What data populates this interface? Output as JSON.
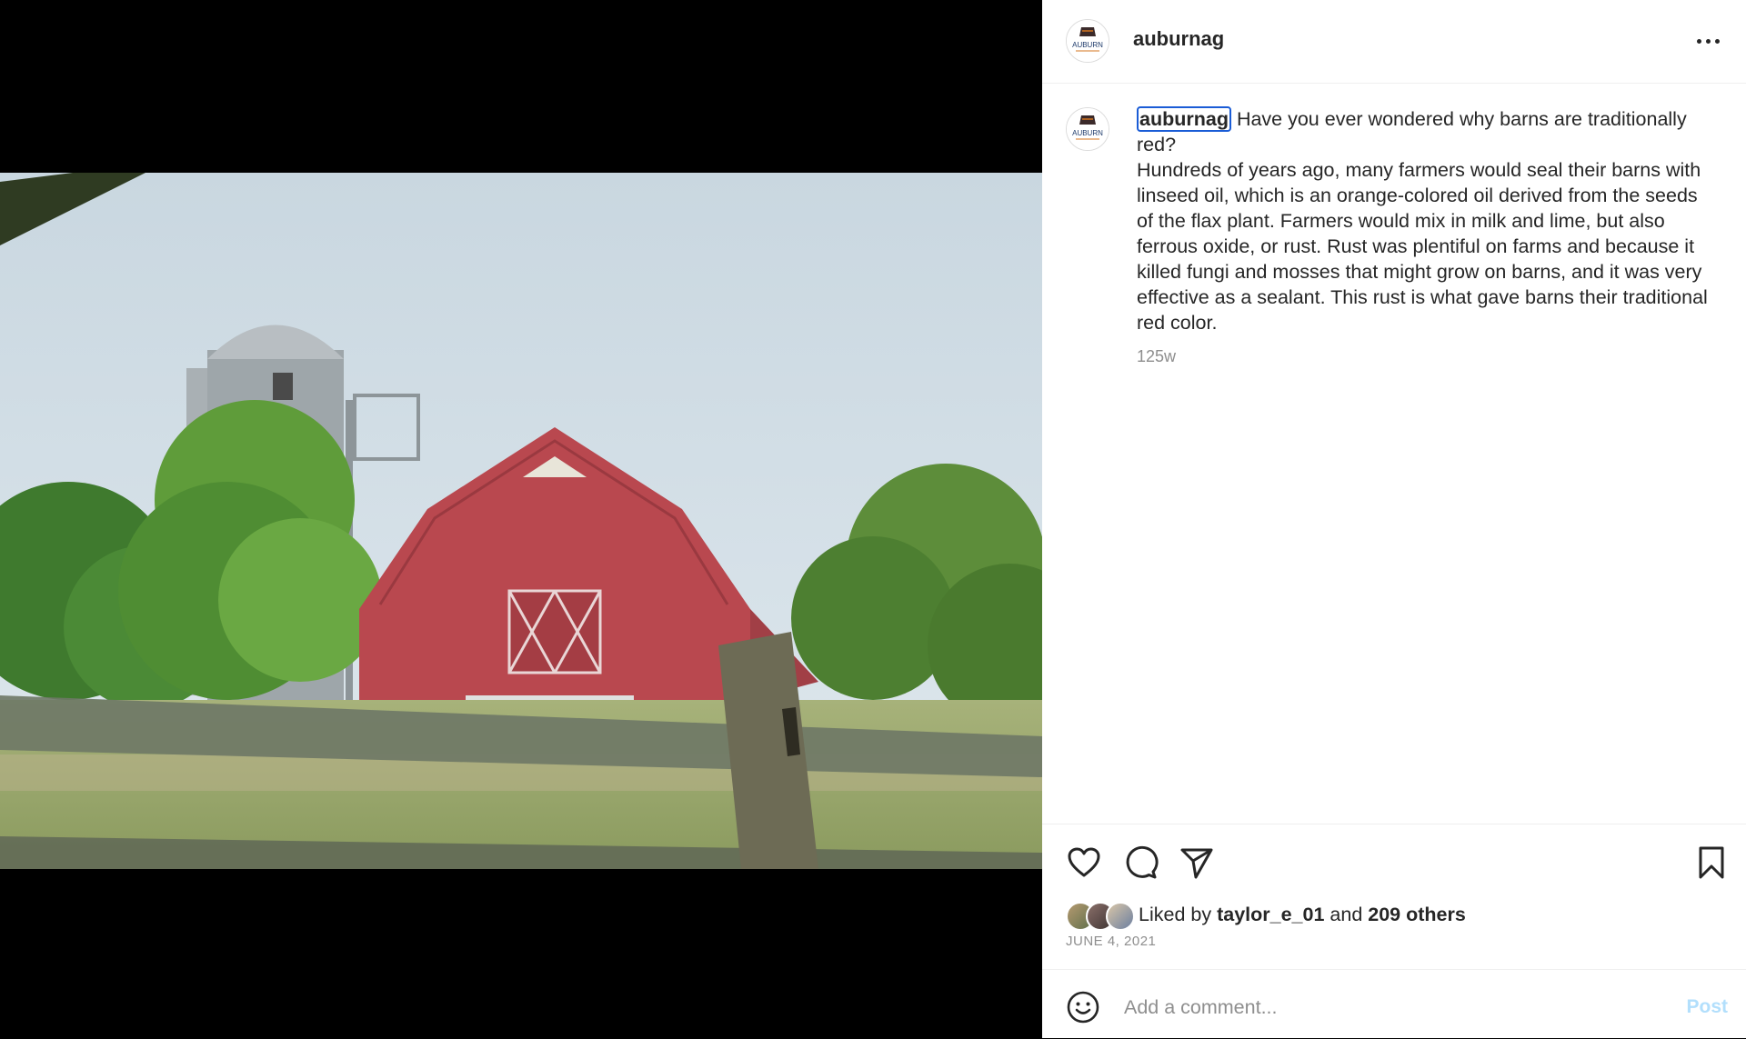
{
  "post": {
    "username": "auburnag",
    "avatar_text": "AUBURN",
    "more_icon": "more-horizontal-icon"
  },
  "caption": {
    "username": "auburnag",
    "title": "Have you ever wondered why barns are traditionally red?",
    "body": "Hundreds of years ago, many farmers would seal their barns with linseed oil, which is an orange-colored oil derived from the seeds of the flax plant. Farmers would mix in milk and lime, but also ferrous oxide, or rust. Rust was plentiful on farms and because it killed fungi and mosses that might grow on barns, and it was very effective as a sealant. This rust is what gave barns their traditional red color.",
    "time_ago": "125w"
  },
  "actions": {
    "like_icon": "heart-icon",
    "comment_icon": "comment-icon",
    "share_icon": "paper-plane-icon",
    "save_icon": "bookmark-icon"
  },
  "likes": {
    "prefix": "Liked by",
    "user": "taylor_e_01",
    "joiner": "and",
    "others": "209 others"
  },
  "date": "JUNE 4, 2021",
  "comment_box": {
    "placeholder": "Add a comment...",
    "post_label": "Post",
    "emoji_icon": "smiley-icon"
  },
  "colors": {
    "focus_outline": "#1a5cd6",
    "post_disabled": "#b2dffc",
    "secondary_text": "#8e8e8e"
  }
}
